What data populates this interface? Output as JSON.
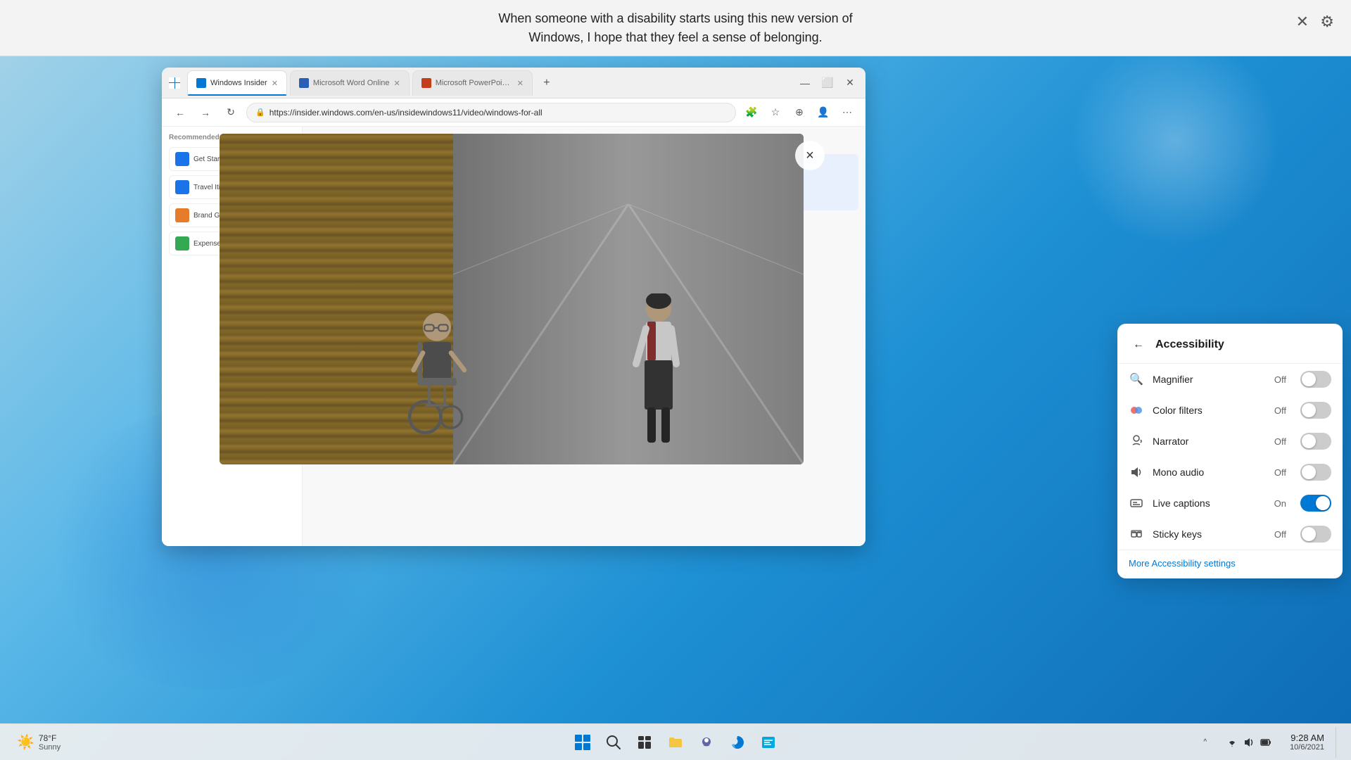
{
  "notification": {
    "text_line1": "When someone with a disability starts using this new version of",
    "text_line2": "Windows, I hope that they feel a sense of belonging."
  },
  "browser": {
    "tabs": [
      {
        "id": "tab-insider",
        "label": "Windows Insider",
        "active": true,
        "icon_color": "#0078d4"
      },
      {
        "id": "tab-word",
        "label": "Microsoft Word Online",
        "active": false,
        "icon_color": "#2b5eb7"
      },
      {
        "id": "tab-ppt",
        "label": "Microsoft PowerPoint Online",
        "active": false,
        "icon_color": "#c43e1c"
      }
    ],
    "url": "https://insider.windows.com/en-us/insidewindows11/video/windows-for-all",
    "new_tab_label": "+",
    "controls": {
      "back": "←",
      "forward": "→",
      "refresh": "↻",
      "more": "⋯"
    }
  },
  "sidebar_cards": [
    {
      "label": "Get Started",
      "type": "blue"
    },
    {
      "label": "Travel Itinerary",
      "type": "blue"
    },
    {
      "label": "Brand Guidelines",
      "type": "orange"
    },
    {
      "label": "Expense Worksheet",
      "type": "green"
    }
  ],
  "video_close": "×",
  "accessibility_panel": {
    "title": "Accessibility",
    "back_arrow": "←",
    "items": [
      {
        "id": "magnifier",
        "label": "Magnifier",
        "status": "Off",
        "on": false,
        "icon": "🔍"
      },
      {
        "id": "color-filters",
        "label": "Color filters",
        "status": "Off",
        "on": false,
        "icon": "🎨"
      },
      {
        "id": "narrator",
        "label": "Narrator",
        "status": "Off",
        "on": false,
        "icon": "🔊"
      },
      {
        "id": "mono-audio",
        "label": "Mono audio",
        "status": "Off",
        "on": false,
        "icon": "🔉"
      },
      {
        "id": "live-captions",
        "label": "Live captions",
        "status": "On",
        "on": true,
        "icon": "📺"
      },
      {
        "id": "sticky-keys",
        "label": "Sticky keys",
        "status": "Off",
        "on": false,
        "icon": "⌨"
      }
    ],
    "footer_link": "More Accessibility settings"
  },
  "taskbar": {
    "weather": {
      "temp": "78°F",
      "condition": "Sunny",
      "icon": "☀️"
    },
    "system_icons": {
      "chevron": "^",
      "network": "📶",
      "sound": "🔊",
      "battery": "🔋"
    },
    "time": "9:28 AM",
    "date": "10/6/2021",
    "apps": [
      {
        "id": "start",
        "type": "start"
      },
      {
        "id": "search",
        "icon": "🔍"
      },
      {
        "id": "task-view",
        "icon": "⊟"
      },
      {
        "id": "explorer",
        "icon": "📁"
      },
      {
        "id": "chat",
        "icon": "💬"
      },
      {
        "id": "edge",
        "icon": "🌐"
      },
      {
        "id": "news",
        "icon": "📰"
      }
    ]
  }
}
